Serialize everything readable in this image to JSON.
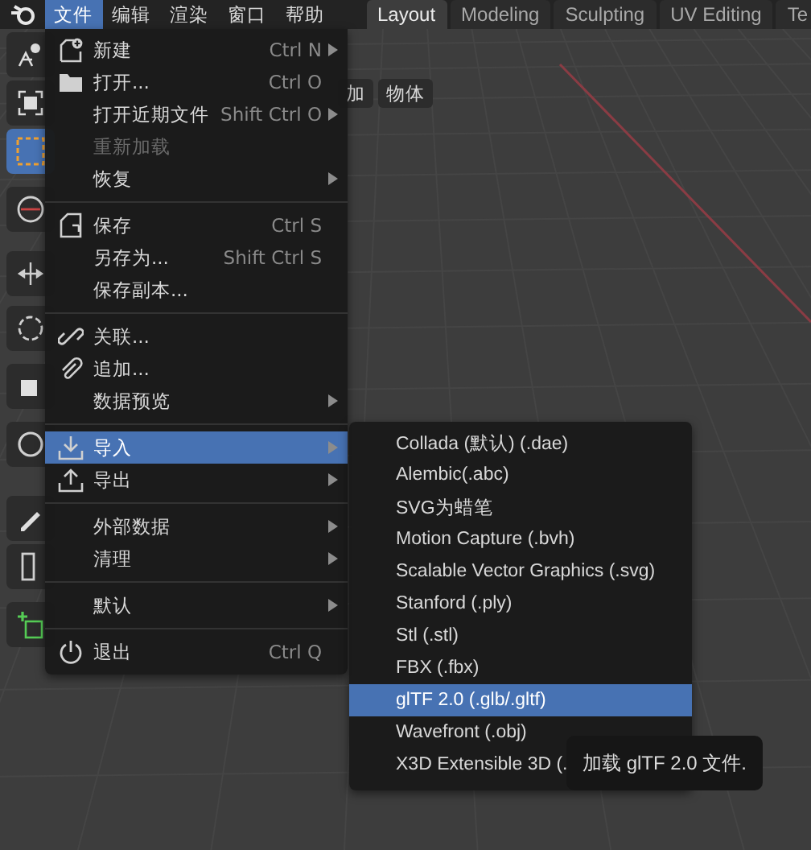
{
  "menubar": [
    {
      "label": "文件",
      "selected": true
    },
    {
      "label": "编辑",
      "selected": false
    },
    {
      "label": "渲染",
      "selected": false
    },
    {
      "label": "窗口",
      "selected": false
    },
    {
      "label": "帮助",
      "selected": false
    }
  ],
  "workspace_tabs": [
    {
      "label": "Layout",
      "selected": true
    },
    {
      "label": "Modeling",
      "selected": false
    },
    {
      "label": "Sculpting",
      "selected": false
    },
    {
      "label": "UV Editing",
      "selected": false
    },
    {
      "label": "Te",
      "selected": false
    }
  ],
  "header_buttons": [
    "加",
    "物体"
  ],
  "file_menu": [
    {
      "kind": "item",
      "label": "新建",
      "shortcut": "Ctrl N",
      "submenu": true,
      "disabled": false,
      "selected": false
    },
    {
      "kind": "item",
      "label": "打开...",
      "shortcut": "Ctrl O",
      "submenu": false,
      "disabled": false,
      "selected": false
    },
    {
      "kind": "item",
      "label": "打开近期文件",
      "shortcut": "Shift Ctrl O",
      "submenu": true,
      "disabled": false,
      "selected": false
    },
    {
      "kind": "item",
      "label": "重新加载",
      "submenu": false,
      "disabled": true,
      "selected": false
    },
    {
      "kind": "item",
      "label": "恢复",
      "submenu": true,
      "disabled": false,
      "selected": false
    },
    {
      "kind": "separator"
    },
    {
      "kind": "item",
      "label": "保存",
      "shortcut": "Ctrl S",
      "submenu": false,
      "disabled": false,
      "selected": false
    },
    {
      "kind": "item",
      "label": "另存为...",
      "shortcut": "Shift Ctrl S",
      "submenu": false,
      "disabled": false,
      "selected": false
    },
    {
      "kind": "item",
      "label": "保存副本...",
      "submenu": false,
      "disabled": false,
      "selected": false
    },
    {
      "kind": "separator"
    },
    {
      "kind": "item",
      "label": "关联...",
      "submenu": false,
      "disabled": false,
      "selected": false
    },
    {
      "kind": "item",
      "label": "追加...",
      "submenu": false,
      "disabled": false,
      "selected": false
    },
    {
      "kind": "item",
      "label": "数据预览",
      "submenu": true,
      "disabled": false,
      "selected": false
    },
    {
      "kind": "separator"
    },
    {
      "kind": "item",
      "label": "导入",
      "submenu": true,
      "disabled": false,
      "selected": true
    },
    {
      "kind": "item",
      "label": "导出",
      "submenu": true,
      "disabled": false,
      "selected": false
    },
    {
      "kind": "separator"
    },
    {
      "kind": "item",
      "label": "外部数据",
      "submenu": true,
      "disabled": false,
      "selected": false
    },
    {
      "kind": "item",
      "label": "清理",
      "submenu": true,
      "disabled": false,
      "selected": false
    },
    {
      "kind": "separator"
    },
    {
      "kind": "item",
      "label": "默认",
      "submenu": true,
      "disabled": false,
      "selected": false
    },
    {
      "kind": "separator"
    },
    {
      "kind": "item",
      "label": "退出",
      "shortcut": "Ctrl Q",
      "submenu": false,
      "disabled": false,
      "selected": false
    }
  ],
  "import_submenu": [
    {
      "label": "Collada (默认) (.dae)",
      "selected": false
    },
    {
      "label": "Alembic(.abc)",
      "selected": false
    },
    {
      "label": "SVG为蜡笔",
      "selected": false
    },
    {
      "label": "Motion Capture (.bvh)",
      "selected": false
    },
    {
      "label": "Scalable Vector Graphics (.svg)",
      "selected": false
    },
    {
      "label": "Stanford (.ply)",
      "selected": false
    },
    {
      "label": "Stl (.stl)",
      "selected": false
    },
    {
      "label": "FBX (.fbx)",
      "selected": false
    },
    {
      "label": "glTF 2.0 (.glb/.gltf)",
      "selected": true
    },
    {
      "label": "Wavefront (.obj)",
      "selected": false
    },
    {
      "label": "X3D Extensible 3D (.",
      "selected": false
    }
  ],
  "tooltip": "加载 glTF 2.0 文件."
}
